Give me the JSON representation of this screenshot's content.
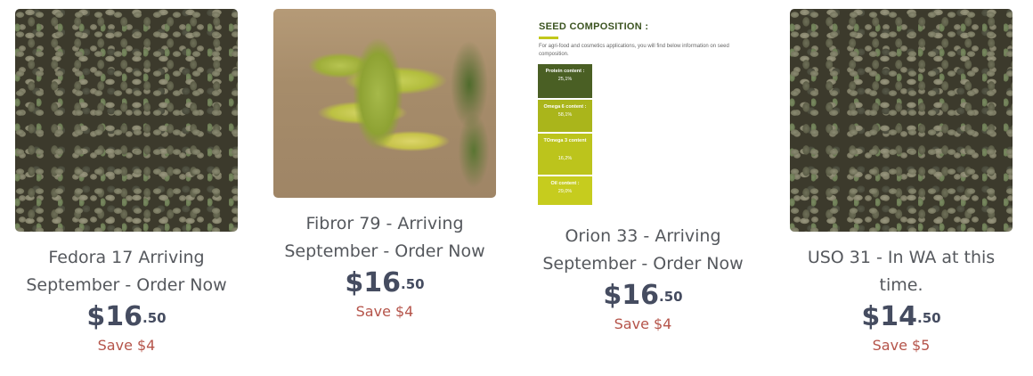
{
  "products": [
    {
      "title": "Fedora 17 Arriving September - Order Now",
      "price_dollars": "$16",
      "price_cents": ".50",
      "save": "Save $4",
      "image": "hemp-seeds-photo"
    },
    {
      "title": "Fibror 79 - Arriving September - Order Now",
      "price_dollars": "$16",
      "price_cents": ".50",
      "save": "Save $4",
      "image": "hemp-plant-photo"
    },
    {
      "title": "Orion 33 - Arriving September - Order Now",
      "price_dollars": "$16",
      "price_cents": ".50",
      "save": "Save $4",
      "image": "seed-composition-infographic"
    },
    {
      "title": "USO 31 - In WA at this time.",
      "price_dollars": "$14",
      "price_cents": ".50",
      "save": "Save $5",
      "image": "hemp-seeds-photo"
    }
  ],
  "composition": {
    "title": "SEED COMPOSITION :",
    "description": "For agri-food and cosmetics applications, you will find below information on seed composition.",
    "items": [
      {
        "label": "Protein content :",
        "value": "25,1%",
        "color": "#4a5f24"
      },
      {
        "label": "Omega 6 content :",
        "value": "58,1%",
        "color": "#aab51b"
      },
      {
        "label": "TOmega 3 content",
        "value": "16,2%",
        "color": "#bcc41c"
      },
      {
        "label": "Oil content :",
        "value": "29,0%",
        "color": "#c6cc1e"
      }
    ]
  },
  "colors": {
    "title": "#55585d",
    "price": "#454c60",
    "save": "#b5544a"
  }
}
